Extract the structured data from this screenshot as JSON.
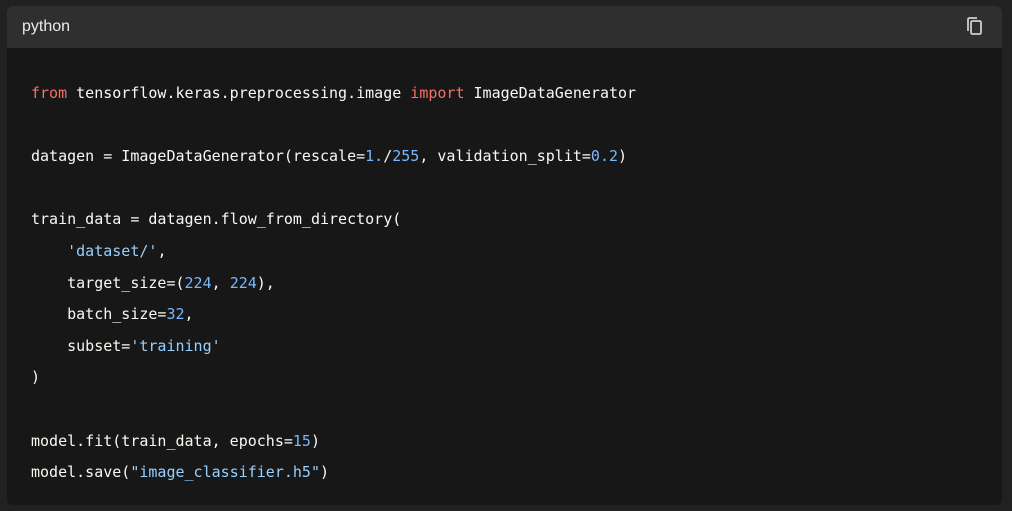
{
  "header": {
    "language": "python",
    "copy_icon": "copy-icon"
  },
  "code": {
    "lines": [
      [
        {
          "t": "kw",
          "v": "from"
        },
        {
          "t": "plain",
          "v": " tensorflow.keras.preprocessing.image "
        },
        {
          "t": "kw",
          "v": "import"
        },
        {
          "t": "plain",
          "v": " ImageDataGenerator"
        }
      ],
      [],
      [
        {
          "t": "plain",
          "v": "datagen = ImageDataGenerator(rescale="
        },
        {
          "t": "num",
          "v": "1."
        },
        {
          "t": "plain",
          "v": "/"
        },
        {
          "t": "num",
          "v": "255"
        },
        {
          "t": "plain",
          "v": ", validation_split="
        },
        {
          "t": "num",
          "v": "0.2"
        },
        {
          "t": "plain",
          "v": ")"
        }
      ],
      [],
      [
        {
          "t": "plain",
          "v": "train_data = datagen.flow_from_directory("
        }
      ],
      [
        {
          "t": "plain",
          "v": "    "
        },
        {
          "t": "str",
          "v": "'dataset/'"
        },
        {
          "t": "plain",
          "v": ","
        }
      ],
      [
        {
          "t": "plain",
          "v": "    target_size=("
        },
        {
          "t": "num",
          "v": "224"
        },
        {
          "t": "plain",
          "v": ", "
        },
        {
          "t": "num",
          "v": "224"
        },
        {
          "t": "plain",
          "v": "),"
        }
      ],
      [
        {
          "t": "plain",
          "v": "    batch_size="
        },
        {
          "t": "num",
          "v": "32"
        },
        {
          "t": "plain",
          "v": ","
        }
      ],
      [
        {
          "t": "plain",
          "v": "    subset="
        },
        {
          "t": "str",
          "v": "'training'"
        }
      ],
      [
        {
          "t": "plain",
          "v": ")"
        }
      ],
      [],
      [
        {
          "t": "plain",
          "v": "model.fit(train_data, epochs="
        },
        {
          "t": "num",
          "v": "15"
        },
        {
          "t": "plain",
          "v": ")"
        }
      ],
      [
        {
          "t": "plain",
          "v": "model.save("
        },
        {
          "t": "str",
          "v": "\"image_classifier.h5\""
        },
        {
          "t": "plain",
          "v": ")"
        }
      ]
    ]
  },
  "colors": {
    "keyword": "#f47067",
    "number": "#79b8ff",
    "string": "#96d0ff",
    "text": "#f8f8f2",
    "header_bg": "#2f2f2f",
    "code_bg": "#171717"
  }
}
